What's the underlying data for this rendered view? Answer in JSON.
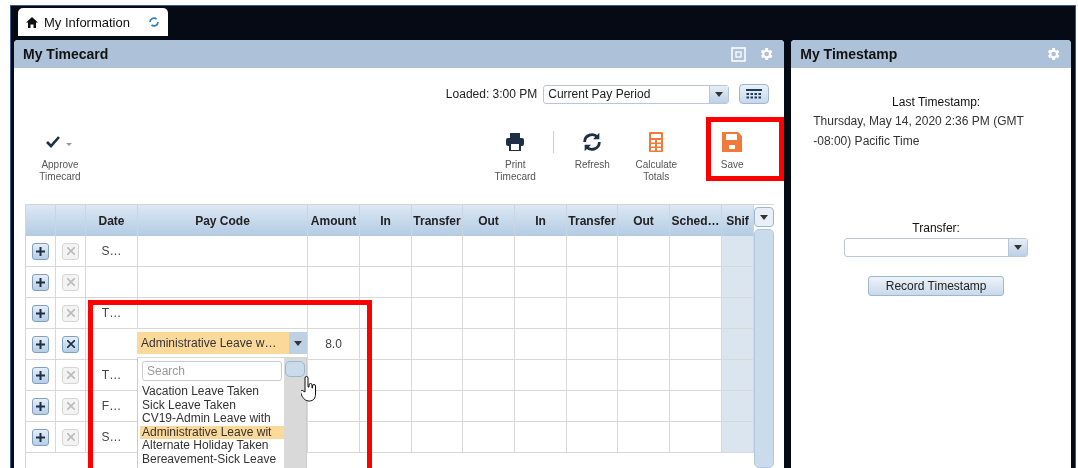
{
  "tab": {
    "label": "My Information"
  },
  "timecard": {
    "title": "My Timecard",
    "loaded": "Loaded: 3:00 PM",
    "period": "Current Pay Period",
    "actions": [
      {
        "kind": "approve",
        "label": "Approve Timecard"
      },
      {
        "kind": "print",
        "label": "Print Timecard"
      },
      {
        "kind": "refresh",
        "label": "Refresh"
      },
      {
        "kind": "calculate",
        "label": "Calculate Totals"
      },
      {
        "kind": "save",
        "label": "Save"
      }
    ],
    "columns": [
      "Date",
      "Pay Code",
      "Amount",
      "In",
      "Transfer",
      "Out",
      "In",
      "Transfer",
      "Out",
      "Sched…",
      "Shif"
    ],
    "rows": [
      {
        "date": "S…",
        "amount": "",
        "delete_enabled": false
      },
      {
        "date": "",
        "amount": "",
        "delete_enabled": false
      },
      {
        "date": "T…",
        "amount": "",
        "delete_enabled": false
      },
      {
        "date": "",
        "amount": "8.0",
        "delete_enabled": true
      },
      {
        "date": "T…",
        "amount": "",
        "delete_enabled": false
      },
      {
        "date": "F…",
        "amount": "",
        "delete_enabled": false
      },
      {
        "date": "S…",
        "amount": "",
        "delete_enabled": false
      }
    ],
    "pay_code_dropdown": {
      "value": "Administrative Leave w…",
      "search_placeholder": "Search",
      "options": [
        {
          "label": "Vacation Leave Taken",
          "selected": false
        },
        {
          "label": "Sick Leave Taken",
          "selected": false
        },
        {
          "label": "CV19-Admin Leave with",
          "selected": false
        },
        {
          "label": "Administrative Leave wit",
          "selected": true
        },
        {
          "label": "Alternate Holiday Taken",
          "selected": false
        },
        {
          "label": "Bereavement-Sick Leave",
          "selected": false
        }
      ]
    }
  },
  "timestamp": {
    "title": "My Timestamp",
    "heading": "Last Timestamp:",
    "value": "Thursday, May 14, 2020 2:36 PM (GMT -08:00) Pacific Time",
    "transfer_label": "Transfer:",
    "button": "Record Timestamp"
  }
}
